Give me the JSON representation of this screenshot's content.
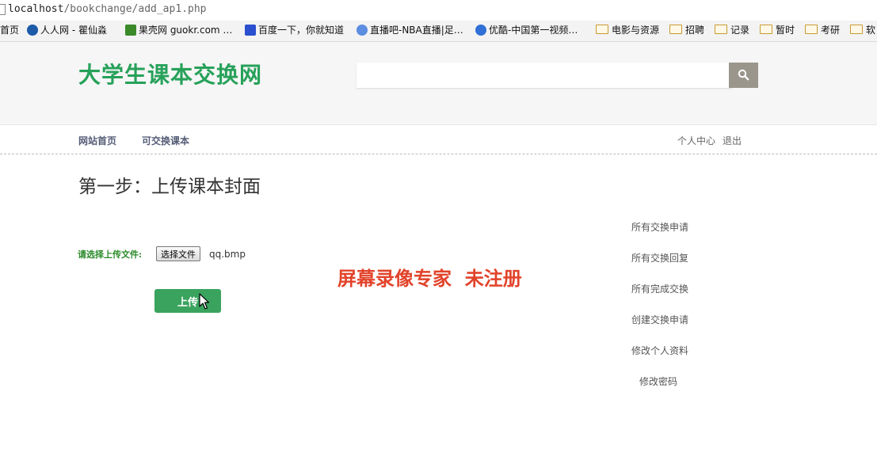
{
  "browser": {
    "url_host": "localhost",
    "url_path": "/bookchange/add_ap1.php",
    "bookmarks": [
      {
        "label": "首页",
        "icon": "",
        "color": ""
      },
      {
        "label": "人人网 - 瞿仙淼",
        "icon": "renren-icon",
        "color": "#1d5aa8"
      },
      {
        "label": "果壳网 guokr.com …",
        "icon": "guokr-icon",
        "color": "#3a8a2a"
      },
      {
        "label": "百度一下，你就知道",
        "icon": "baidu-paw-icon",
        "color": "#2a4fcf"
      },
      {
        "label": "直播吧-NBA直播|足…",
        "icon": "zhibo8-icon",
        "color": "#5b8de0"
      },
      {
        "label": "优酷-中国第一视频…",
        "icon": "youku-play-icon",
        "color": "#2f6fd6"
      },
      {
        "label": "电影与资源",
        "icon": "folder-icon",
        "color": ""
      },
      {
        "label": "招聘",
        "icon": "folder-icon",
        "color": ""
      },
      {
        "label": "记录",
        "icon": "folder-icon",
        "color": ""
      },
      {
        "label": "暂时",
        "icon": "folder-icon",
        "color": ""
      },
      {
        "label": "考研",
        "icon": "folder-icon",
        "color": ""
      },
      {
        "label": "软",
        "icon": "folder-icon",
        "color": ""
      }
    ]
  },
  "site": {
    "logo": "大学生课本交换网",
    "accent": "#27a15a",
    "search": {
      "value": "",
      "button_icon": "search-icon"
    }
  },
  "nav": {
    "home": "网站首页",
    "books": "可交换课本",
    "profile": "个人中心",
    "logout": "退出"
  },
  "main": {
    "title": "第一步：上传课本封面",
    "file_label": "请选择上传文件:",
    "file_button": "选择文件",
    "file_name": "qq.bmp",
    "upload_button": "上传"
  },
  "sidebar": {
    "items": [
      "所有交换申请",
      "所有交换回复",
      "所有完成交换",
      "创建交换申请",
      "修改个人资料",
      "修改密码"
    ]
  },
  "overlay": {
    "watermark": "屏幕录像专家  未注册",
    "color": "#e2432a"
  }
}
